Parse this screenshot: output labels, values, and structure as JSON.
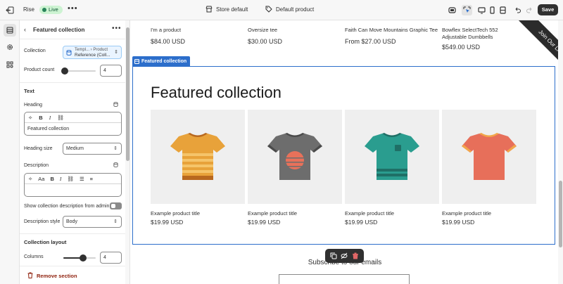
{
  "topbar": {
    "app_name": "Rise",
    "status": "Live",
    "store_label": "Store default",
    "product_label": "Default product",
    "save_label": "Save"
  },
  "panel": {
    "title": "Featured collection",
    "collection_label": "Collection",
    "collection_ref_line1": "Templ... › Product",
    "collection_ref_line2": "Reference (Coll...",
    "product_count_label": "Product count",
    "product_count_value": "4",
    "product_count_fraction": 0.05,
    "text_section": "Text",
    "heading_label": "Heading",
    "heading_value": "Featured collection",
    "heading_size_label": "Heading size",
    "heading_size_value": "Medium",
    "description_label": "Description",
    "description_value": "",
    "show_desc_label": "Show collection description from admin",
    "show_desc_on": false,
    "desc_style_label": "Description style",
    "desc_style_value": "Body",
    "layout_section": "Collection layout",
    "columns_label": "Columns",
    "columns_value": "4",
    "columns_fraction": 0.6,
    "remove_label": "Remove section"
  },
  "preview": {
    "top_products": [
      {
        "name": "I'm a product",
        "price": "$84.00 USD"
      },
      {
        "name": "Oversize tee",
        "price": "$30.00 USD"
      },
      {
        "name": "Faith Can Move Mountains Graphic Tee",
        "price": "From $27.00 USD"
      },
      {
        "name": "Bowflex SelectTech 552 Adjustable Dumbbells",
        "price": "$549.00 USD"
      }
    ],
    "ribbon_text": "Join Our List!",
    "section_tag": "Featured collection",
    "section_title": "Featured collection",
    "cards": [
      {
        "name": "Example product title",
        "price": "$19.99 USD",
        "shirt_color": "#e8a23a",
        "stripe_color": "#f5c46a",
        "accent": "#b8681f"
      },
      {
        "name": "Example product title",
        "price": "$19.99 USD",
        "shirt_color": "#6d6d6d",
        "stripe_color": "#e8715a",
        "accent": "#4a4a4a"
      },
      {
        "name": "Example product title",
        "price": "$19.99 USD",
        "shirt_color": "#2a9d8f",
        "stripe_color": "#1f6f66",
        "accent": "#1f6f66"
      },
      {
        "name": "Example product title",
        "price": "$19.99 USD",
        "shirt_color": "#e76f5a",
        "stripe_color": "#f2a64a",
        "accent": "#f2a64a"
      }
    ],
    "subscribe_text": "Subscribe to our emails"
  }
}
